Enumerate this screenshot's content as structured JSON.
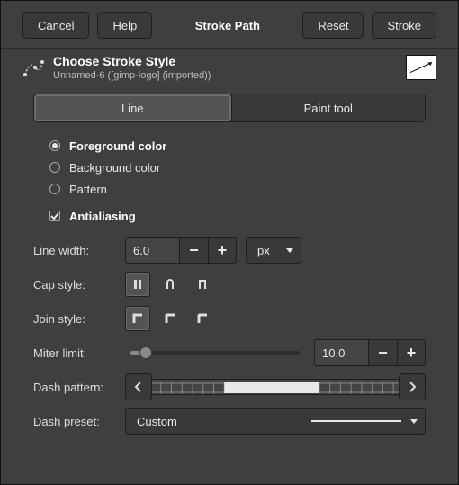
{
  "buttons": {
    "cancel": "Cancel",
    "help": "Help",
    "title": "Stroke Path",
    "reset": "Reset",
    "stroke": "Stroke"
  },
  "header": {
    "title": "Choose Stroke Style",
    "subtitle": "Unnamed-6 ([gimp-logo] (imported))"
  },
  "tabs": {
    "line": "Line",
    "paint": "Paint tool"
  },
  "color_source": {
    "foreground": "Foreground color",
    "background": "Background color",
    "pattern": "Pattern",
    "selected": "foreground"
  },
  "antialiasing": {
    "label": "Antialiasing",
    "checked": true
  },
  "line_width": {
    "label": "Line width:",
    "value": "6.0",
    "unit": "px"
  },
  "cap_style": {
    "label": "Cap style:",
    "selected": 0
  },
  "join_style": {
    "label": "Join style:",
    "selected": 0
  },
  "miter_limit": {
    "label": "Miter limit:",
    "value": "10.0",
    "slider_pct": 9
  },
  "dash_pattern": {
    "label": "Dash pattern:"
  },
  "dash_preset": {
    "label": "Dash preset:",
    "value": "Custom"
  }
}
